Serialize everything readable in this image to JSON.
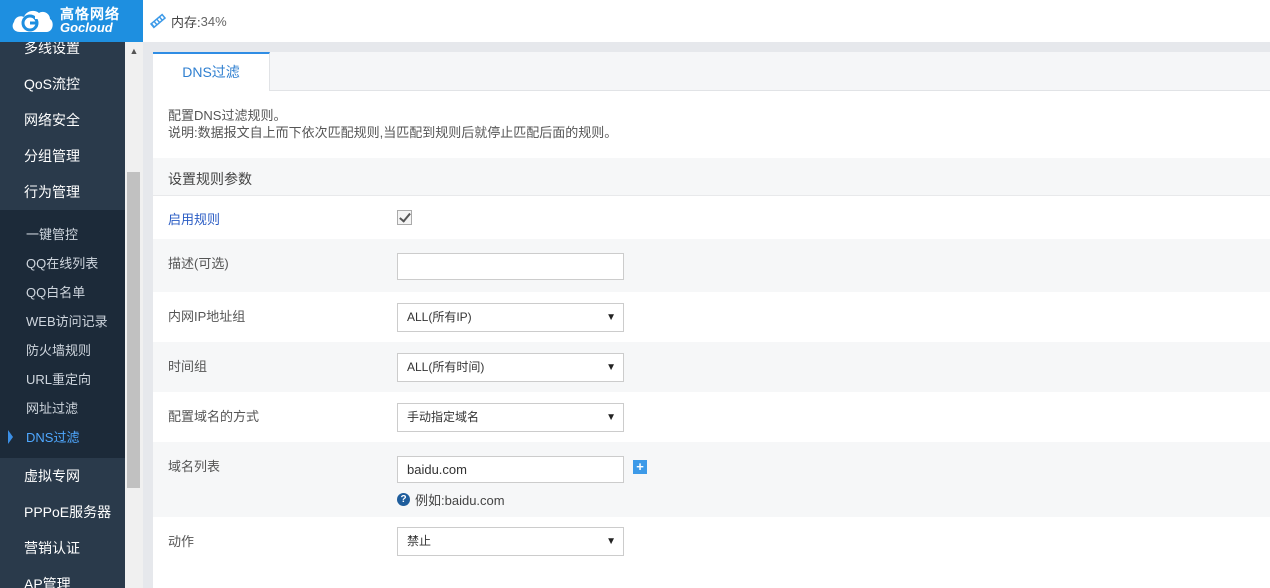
{
  "logo": {
    "cn": "高恪网络",
    "en": "Gocloud"
  },
  "topbar": {
    "memory_label": "内存:",
    "memory_value": "34%"
  },
  "sidebar": {
    "main_items_top": [
      "多线设置",
      "QoS流控",
      "网络安全",
      "分组管理",
      "行为管理"
    ],
    "sub_items": [
      "一键管控",
      "QQ在线列表",
      "QQ白名单",
      "WEB访问记录",
      "防火墙规则",
      "URL重定向",
      "网址过滤",
      "DNS过滤"
    ],
    "active_sub": "DNS过滤",
    "main_items_bottom": [
      "虚拟专网",
      "PPPoE服务器",
      "营销认证",
      "AP管理"
    ]
  },
  "tab": {
    "label": "DNS过滤"
  },
  "intro": {
    "line1": "配置DNS过滤规则。",
    "line2": "说明:数据报文自上而下依次匹配规则,当匹配到规则后就停止匹配后面的规则。"
  },
  "form": {
    "section_title": "设置规则参数",
    "enable": {
      "label": "启用规则",
      "checked": true
    },
    "description": {
      "label": "描述(可选)",
      "value": ""
    },
    "ip_group": {
      "label": "内网IP地址组",
      "selected": "ALL(所有IP)"
    },
    "time_group": {
      "label": "时间组",
      "selected": "ALL(所有时间)"
    },
    "domain_mode": {
      "label": "配置域名的方式",
      "selected": "手动指定域名"
    },
    "domain_list": {
      "label": "域名列表",
      "value": "baidu.com",
      "add": "+",
      "hint": "例如:baidu.com"
    },
    "action": {
      "label": "动作",
      "selected": "禁止"
    }
  },
  "colors": {
    "brand": "#1e8fe0",
    "sidebar": "#2a3a4b",
    "active": "#4fa8ff"
  }
}
